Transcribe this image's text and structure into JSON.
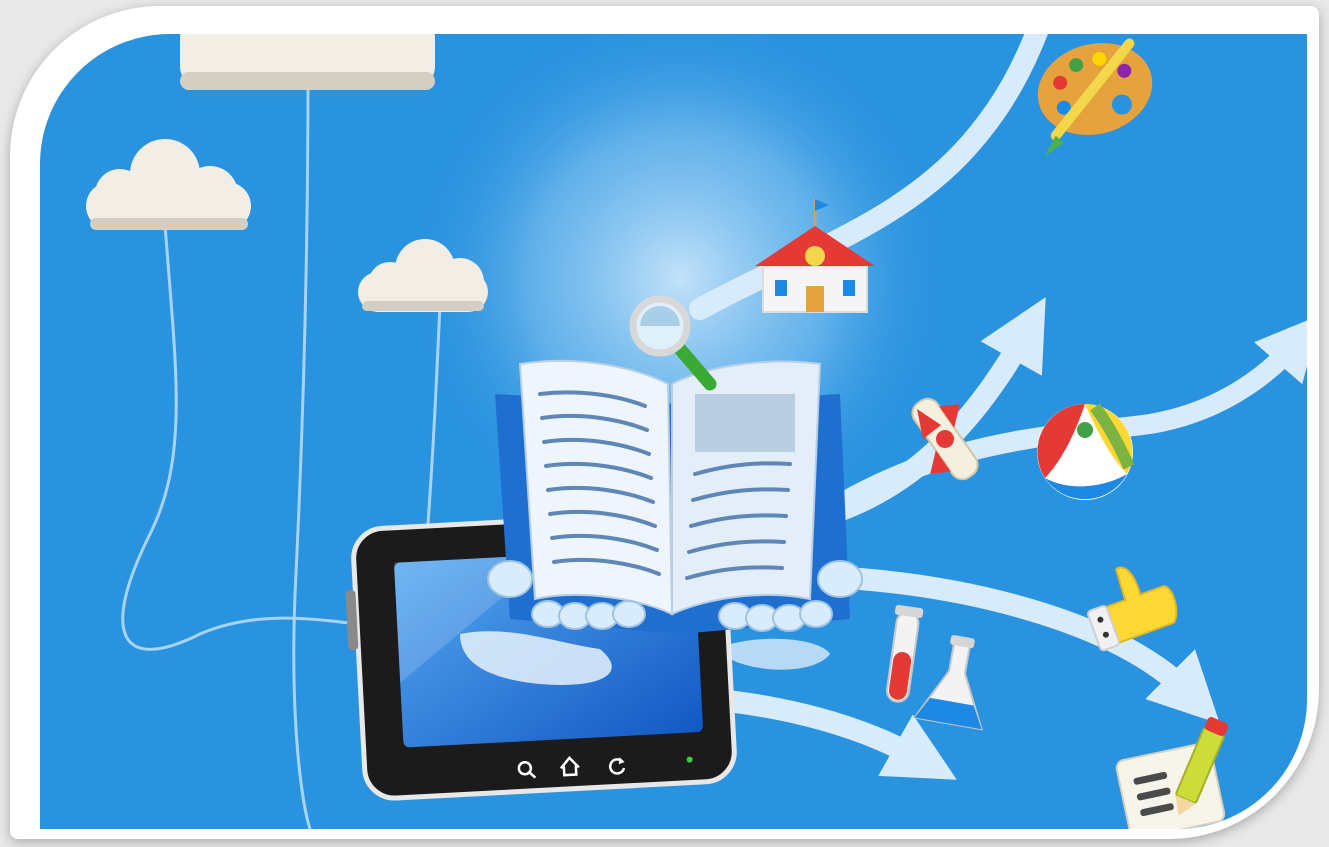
{
  "illustration": {
    "subject": "e-learning-tablet-book",
    "colors": {
      "sky": "#2a93df",
      "sky_light": "#7cc2f2",
      "cloud": "#f2eee6",
      "cloud_shadow": "#d4cfc2",
      "string": "#a9d3f3",
      "arrow": "#d7ebfa",
      "book_cover": "#1f6fd1",
      "page": "#eef5fc",
      "page_line": "#5e86b6",
      "tablet_body": "#1b1b1b",
      "tablet_screen": "#1e6bd8"
    },
    "icons": [
      "cloud-icon",
      "open-book-icon",
      "magnifier-icon",
      "tablet-icon",
      "search-icon",
      "home-icon",
      "refresh-icon",
      "paint-palette-icon",
      "school-icon",
      "diploma-icon",
      "beach-ball-icon",
      "thumbs-up-icon",
      "test-tube-icon",
      "flask-icon",
      "note-pencil-icon"
    ]
  }
}
